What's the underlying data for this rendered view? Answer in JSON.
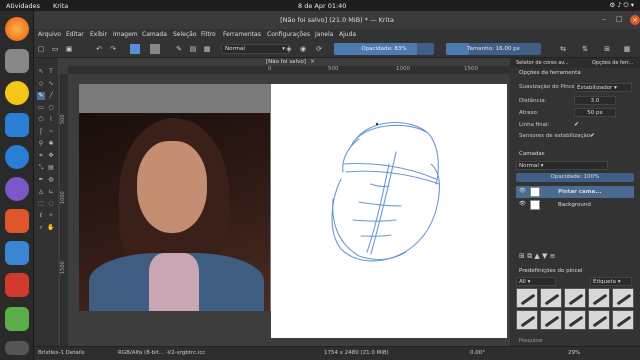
{
  "system": {
    "activities": "Atividades",
    "app": "Krita",
    "clock": "8 de Apr  01:40"
  },
  "window": {
    "title": "[Não foi salvo] (21.0 MiB) * — Krita"
  },
  "menu": [
    "Arquivo",
    "Editar",
    "Exibir",
    "Imagem",
    "Camada",
    "Seleção",
    "Filtro",
    "Ferramentas",
    "Configurações",
    "Janela",
    "Ajuda"
  ],
  "toolbar": {
    "blend_mode": "Normal",
    "opacity_label": "Opacidade: 83%",
    "opacity_value": 0.83,
    "size_label": "Tamanho: 16.00 px"
  },
  "canvas": {
    "tab_title": "[Não foi salvo]",
    "ruler_h": [
      "0",
      "500",
      "1000",
      "1500"
    ],
    "ruler_v": [
      "500",
      "1000",
      "1500"
    ]
  },
  "panel": {
    "tabs": [
      "Seletor de cores av...",
      "Opções de ferr..."
    ],
    "tool_options_title": "Opções da ferramenta",
    "smoothing_label": "Suavização do Pincel:",
    "smoothing_value": "Estabilizador",
    "distance_label": "Distância:",
    "distance_value": "3.0",
    "delay_label": "Atraso:",
    "delay_value": "50 px",
    "finish_line_label": "Linha final:",
    "stabilize_sensors_label": "Sensores de estabilização:",
    "layers_title": "Camadas",
    "layers_blend": "Normal",
    "layers_opacity": "Opacidade: 100%",
    "layers": [
      "Pintar cama...",
      "Background"
    ],
    "presets_title": "Predefinições do pincel",
    "presets_filter": "All",
    "presets_tag": "Etiqueta",
    "search_placeholder": "Pesquisar"
  },
  "status": {
    "brush": "Bristles-1 Details",
    "colorspace": "RGB/Alfa (8-bit... -V2-srgbtrc.icc",
    "dims": "1754 x 2480 (21.0 MiB)",
    "rotation": "0.00°",
    "zoom": "29%"
  }
}
